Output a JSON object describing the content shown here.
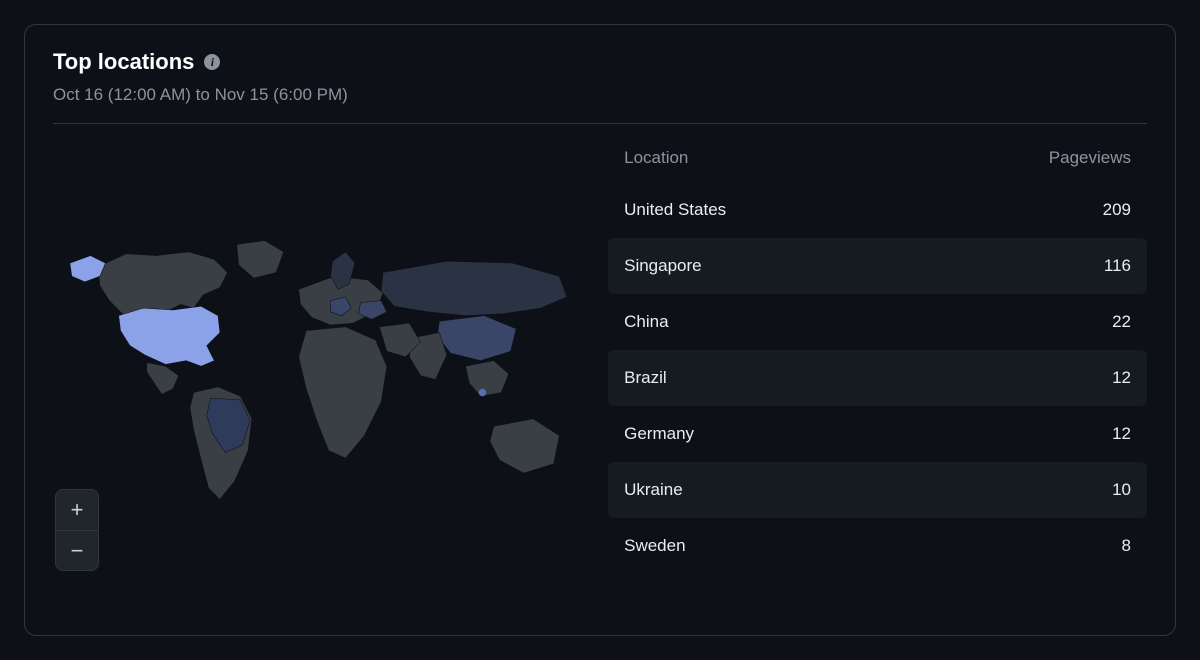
{
  "card": {
    "title": "Top locations",
    "date_range": "Oct 16 (12:00 AM) to Nov 15 (6:00 PM)",
    "zoom_in_label": "+",
    "zoom_out_label": "−"
  },
  "table": {
    "header_location": "Location",
    "header_pageviews": "Pageviews",
    "rows": [
      {
        "location": "United States",
        "pageviews": "209"
      },
      {
        "location": "Singapore",
        "pageviews": "116"
      },
      {
        "location": "China",
        "pageviews": "22"
      },
      {
        "location": "Brazil",
        "pageviews": "12"
      },
      {
        "location": "Germany",
        "pageviews": "12"
      },
      {
        "location": "Ukraine",
        "pageviews": "10"
      },
      {
        "location": "Sweden",
        "pageviews": "8"
      }
    ]
  },
  "chart_data": {
    "type": "table",
    "title": "Top locations",
    "columns": [
      "Location",
      "Pageviews"
    ],
    "rows": [
      [
        "United States",
        209
      ],
      [
        "Singapore",
        116
      ],
      [
        "China",
        22
      ],
      [
        "Brazil",
        12
      ],
      [
        "Germany",
        12
      ],
      [
        "Ukraine",
        10
      ],
      [
        "Sweden",
        8
      ]
    ],
    "map": {
      "type": "choropleth",
      "value_field": "Pageviews",
      "highlighted_countries": [
        "United States",
        "Singapore",
        "China",
        "Brazil",
        "Germany",
        "Ukraine",
        "Sweden"
      ]
    }
  }
}
